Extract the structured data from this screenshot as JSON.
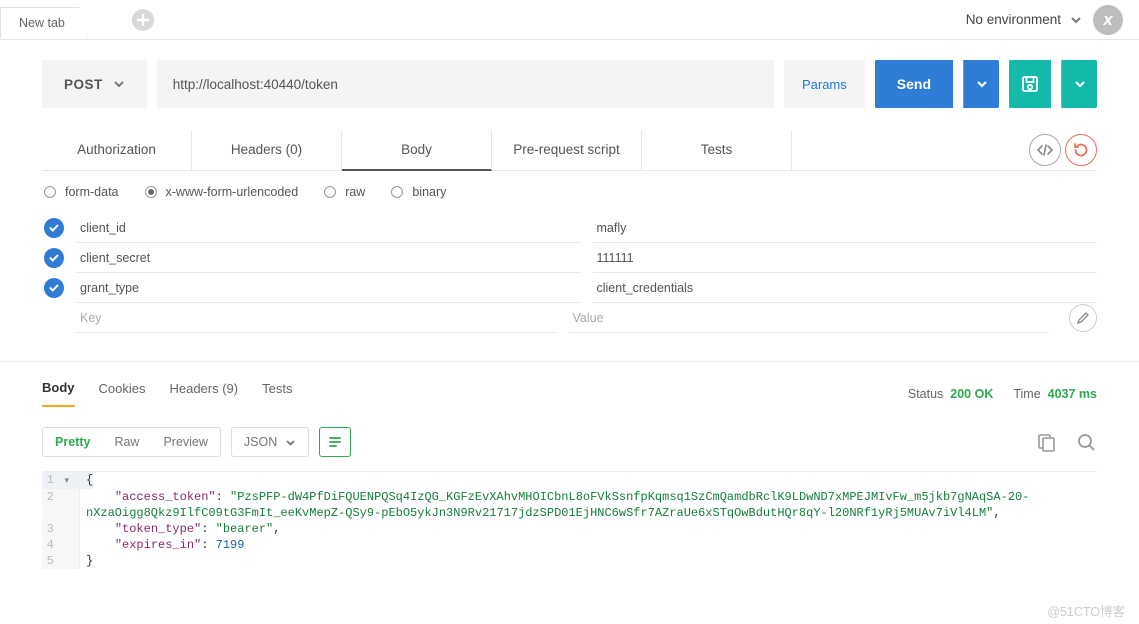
{
  "topbar": {
    "tab_label": "New tab",
    "environment_label": "No environment",
    "variable_glyph": "x"
  },
  "request": {
    "method": "POST",
    "url": "http://localhost:40440/token",
    "params_label": "Params",
    "send_label": "Send"
  },
  "request_tabs": [
    "Authorization",
    "Headers (0)",
    "Body",
    "Pre-request script",
    "Tests"
  ],
  "body_types": [
    {
      "label": "form-data",
      "selected": false
    },
    {
      "label": "x-www-form-urlencoded",
      "selected": true
    },
    {
      "label": "raw",
      "selected": false
    },
    {
      "label": "binary",
      "selected": false
    }
  ],
  "form_rows": [
    {
      "key": "client_id",
      "value": "mafly",
      "enabled": true
    },
    {
      "key": "client_secret",
      "value": "111111",
      "enabled": true
    },
    {
      "key": "grant_type",
      "value": "client_credentials",
      "enabled": true
    }
  ],
  "form_placeholder": {
    "key": "Key",
    "value": "Value"
  },
  "response_tabs": {
    "items": [
      "Body",
      "Cookies",
      "Headers (9)",
      "Tests"
    ],
    "active": 0,
    "status_label": "Status",
    "status_value": "200 OK",
    "time_label": "Time",
    "time_value": "4037 ms"
  },
  "viewer": {
    "modes": [
      "Pretty",
      "Raw",
      "Preview"
    ],
    "lang": "JSON"
  },
  "response_body": {
    "access_token": "PzsPFP-dW4PfDiFQUENPQSq4IzQG_KGFzEvXAhvMHOICbnL8oFVkSsnfpKqmsq1SzCmQamdbRclK9LDwND7xMPEJMIvFw_m5jkb7gNAqSA-20-nXzaOigg8Qkz9IlfC09tG3FmIt_eeKvMepZ-QSy9-pEbO5ykJn3N9Rv21717jdzSPD01EjHNC6wSfr7AZraUe6xSTqOwBdutHQr8qY-l20NRf1yRj5MUAv7iVl4LM",
    "token_type": "bearer",
    "expires_in": 7199
  },
  "watermark": "@51CTO博客"
}
